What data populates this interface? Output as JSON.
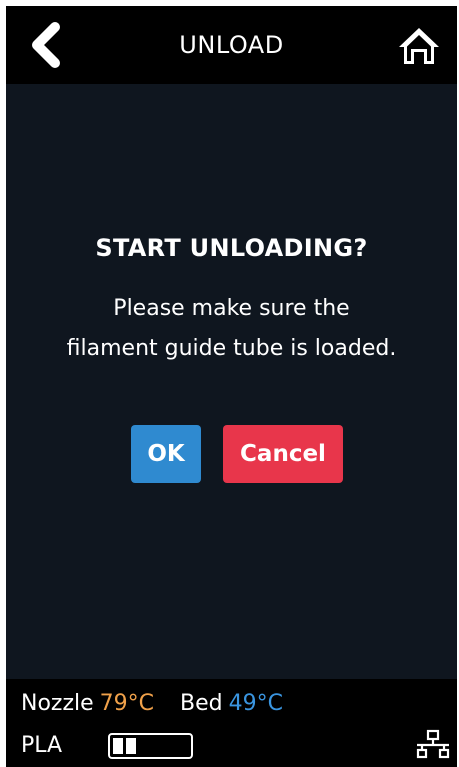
{
  "header": {
    "title": "UNLOAD",
    "back_icon": "chevron-left-icon",
    "home_icon": "home-icon"
  },
  "dialog": {
    "title": "START UNLOADING?",
    "message_lines": [
      "Please make sure the",
      "filament guide tube is loaded."
    ],
    "ok_label": "OK",
    "cancel_label": "Cancel"
  },
  "status": {
    "nozzle_label": "Nozzle",
    "nozzle_temp": "79°C",
    "bed_label": "Bed",
    "bed_temp": "49°C",
    "material": "PLA",
    "filament_level": 0.25,
    "network_icon": "network-icon"
  },
  "colors": {
    "background": "#0f161f",
    "bar": "#000000",
    "ok_button": "#2f8ad0",
    "cancel_button": "#e8364b",
    "nozzle_temp": "#f0a14a",
    "bed_temp": "#3a95e0"
  }
}
